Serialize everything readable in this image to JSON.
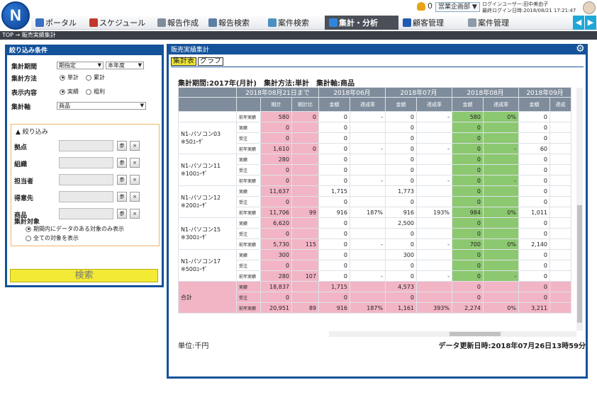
{
  "header": {
    "logo_letter": "N",
    "notification_count": "0",
    "department": "営業企画部",
    "login_user": "ログインユーザー:田中美由子",
    "last_login": "最終ログイン日時:2018/08/21 17:21:47",
    "nav": [
      {
        "label": "ポータル",
        "icon": "portal-icon"
      },
      {
        "label": "スケジュール",
        "icon": "calendar-icon"
      },
      {
        "label": "報告作成",
        "icon": "report-create-icon"
      },
      {
        "label": "報告検索",
        "icon": "report-search-icon"
      },
      {
        "label": "案件検索",
        "icon": "case-search-icon"
      },
      {
        "label": "集計・分析",
        "icon": "analytics-icon"
      },
      {
        "label": "顧客管理",
        "icon": "customer-icon"
      },
      {
        "label": "案件管理",
        "icon": "case-manage-icon"
      }
    ],
    "active_nav": "集計・分析"
  },
  "breadcrumb": "TOP → 販売実績集計",
  "filter": {
    "title": "絞り込み条件",
    "period_label": "集計期間",
    "period_value": "期指定",
    "period_option": "本年度",
    "method_label": "集計方法",
    "method_options": [
      "単計",
      "累計"
    ],
    "method_selected": "単計",
    "display_label": "表示内容",
    "display_options": [
      "実績",
      "粗利"
    ],
    "display_selected": "実績",
    "axis_label": "集計軸",
    "axis_value": "商品",
    "narrow_title": "▲ 絞り込み",
    "fields": [
      {
        "label": "拠点"
      },
      {
        "label": "組織"
      },
      {
        "label": "担当者"
      },
      {
        "label": "得意先"
      },
      {
        "label": "商品"
      }
    ],
    "ref_button": "参",
    "clear_button": "×",
    "target_label": "集計対象",
    "target_options": [
      "期間内にデータのある対象のみ表示",
      "全ての対象を表示"
    ],
    "search_button": "検索"
  },
  "main": {
    "title": "販売実績集計",
    "tabs": [
      "集計表",
      "グラフ"
    ],
    "period_text": "集計期間:2017年(月計)　集計方法:単計　集計軸:商品",
    "unit": "単位:千円",
    "updated": "データ更新日時:2018年07月26日13時59分",
    "header_groups": [
      "2018年08月21日まで",
      "2018年06月",
      "2018年07月",
      "2018年08月",
      "2018年09月"
    ],
    "sub_headers": [
      "期計",
      "期計比",
      "金額",
      "達成率",
      "金額",
      "達成率",
      "金額",
      "達成率",
      "金額",
      "達成"
    ],
    "rows": [
      {
        "name": "",
        "kind": "前年実績",
        "v": [
          "580",
          "0",
          "0",
          "-",
          "0",
          "-",
          "580",
          "0%",
          "0",
          ""
        ]
      },
      {
        "name": "N1-パソコン03\n※50ﾕｰｻﾞ",
        "kind": "実績",
        "v": [
          "0",
          "",
          "0",
          "",
          "0",
          "",
          "0",
          "",
          "0",
          ""
        ]
      },
      {
        "name": "",
        "kind": "受注",
        "v": [
          "0",
          "",
          "0",
          "",
          "0",
          "",
          "0",
          "",
          "0",
          ""
        ]
      },
      {
        "name": "",
        "kind": "前年実績",
        "v": [
          "1,610",
          "0",
          "0",
          "-",
          "0",
          "-",
          "0",
          "-",
          "60",
          ""
        ]
      },
      {
        "name": "N1-パソコン11\n※100ﾕｰｻﾞ",
        "kind": "実績",
        "v": [
          "280",
          "",
          "0",
          "",
          "0",
          "",
          "0",
          "",
          "0",
          ""
        ]
      },
      {
        "name": "",
        "kind": "受注",
        "v": [
          "0",
          "",
          "0",
          "",
          "0",
          "",
          "0",
          "",
          "0",
          ""
        ]
      },
      {
        "name": "",
        "kind": "前年実績",
        "v": [
          "0",
          "",
          "0",
          "-",
          "0",
          "-",
          "0",
          "-",
          "0",
          ""
        ]
      },
      {
        "name": "N1-パソコン12\n※200ﾕｰｻﾞ",
        "kind": "実績",
        "v": [
          "11,637",
          "",
          "1,715",
          "",
          "1,773",
          "",
          "0",
          "",
          "0",
          ""
        ]
      },
      {
        "name": "",
        "kind": "受注",
        "v": [
          "0",
          "",
          "0",
          "",
          "0",
          "",
          "0",
          "",
          "0",
          ""
        ]
      },
      {
        "name": "",
        "kind": "前年実績",
        "v": [
          "11,706",
          "99",
          "916",
          "187%",
          "916",
          "193%",
          "984",
          "0%",
          "1,011",
          ""
        ]
      },
      {
        "name": "N1-パソコン15\n※300ﾕｰｻﾞ",
        "kind": "実績",
        "v": [
          "6,620",
          "",
          "0",
          "",
          "2,500",
          "",
          "0",
          "",
          "0",
          ""
        ]
      },
      {
        "name": "",
        "kind": "受注",
        "v": [
          "0",
          "",
          "0",
          "",
          "0",
          "",
          "0",
          "",
          "0",
          ""
        ]
      },
      {
        "name": "",
        "kind": "前年実績",
        "v": [
          "5,730",
          "115",
          "0",
          "-",
          "0",
          "-",
          "700",
          "0%",
          "2,140",
          ""
        ]
      },
      {
        "name": "N1-パソコン17\n※500ﾕｰｻﾞ",
        "kind": "実績",
        "v": [
          "300",
          "",
          "0",
          "",
          "300",
          "",
          "0",
          "",
          "0",
          ""
        ]
      },
      {
        "name": "",
        "kind": "受注",
        "v": [
          "0",
          "",
          "0",
          "",
          "0",
          "",
          "0",
          "",
          "0",
          ""
        ]
      },
      {
        "name": "",
        "kind": "前年実績",
        "v": [
          "280",
          "107",
          "0",
          "-",
          "0",
          "-",
          "0",
          "-",
          "0",
          ""
        ]
      }
    ],
    "total": {
      "name": "合計",
      "rows": [
        {
          "kind": "実績",
          "v": [
            "18,837",
            "",
            "1,715",
            "",
            "4,573",
            "",
            "0",
            "",
            "0",
            ""
          ]
        },
        {
          "kind": "受注",
          "v": [
            "0",
            "",
            "0",
            "",
            "0",
            "",
            "0",
            "",
            "0",
            ""
          ]
        },
        {
          "kind": "前年実績",
          "v": [
            "20,951",
            "89",
            "916",
            "187%",
            "1,161",
            "393%",
            "2,274",
            "0%",
            "3,211",
            ""
          ]
        }
      ]
    }
  },
  "colors": {
    "primary": "#14529a",
    "pink": "#f2b5c5",
    "green": "#8cc870",
    "search_button": "#f2ea35"
  }
}
